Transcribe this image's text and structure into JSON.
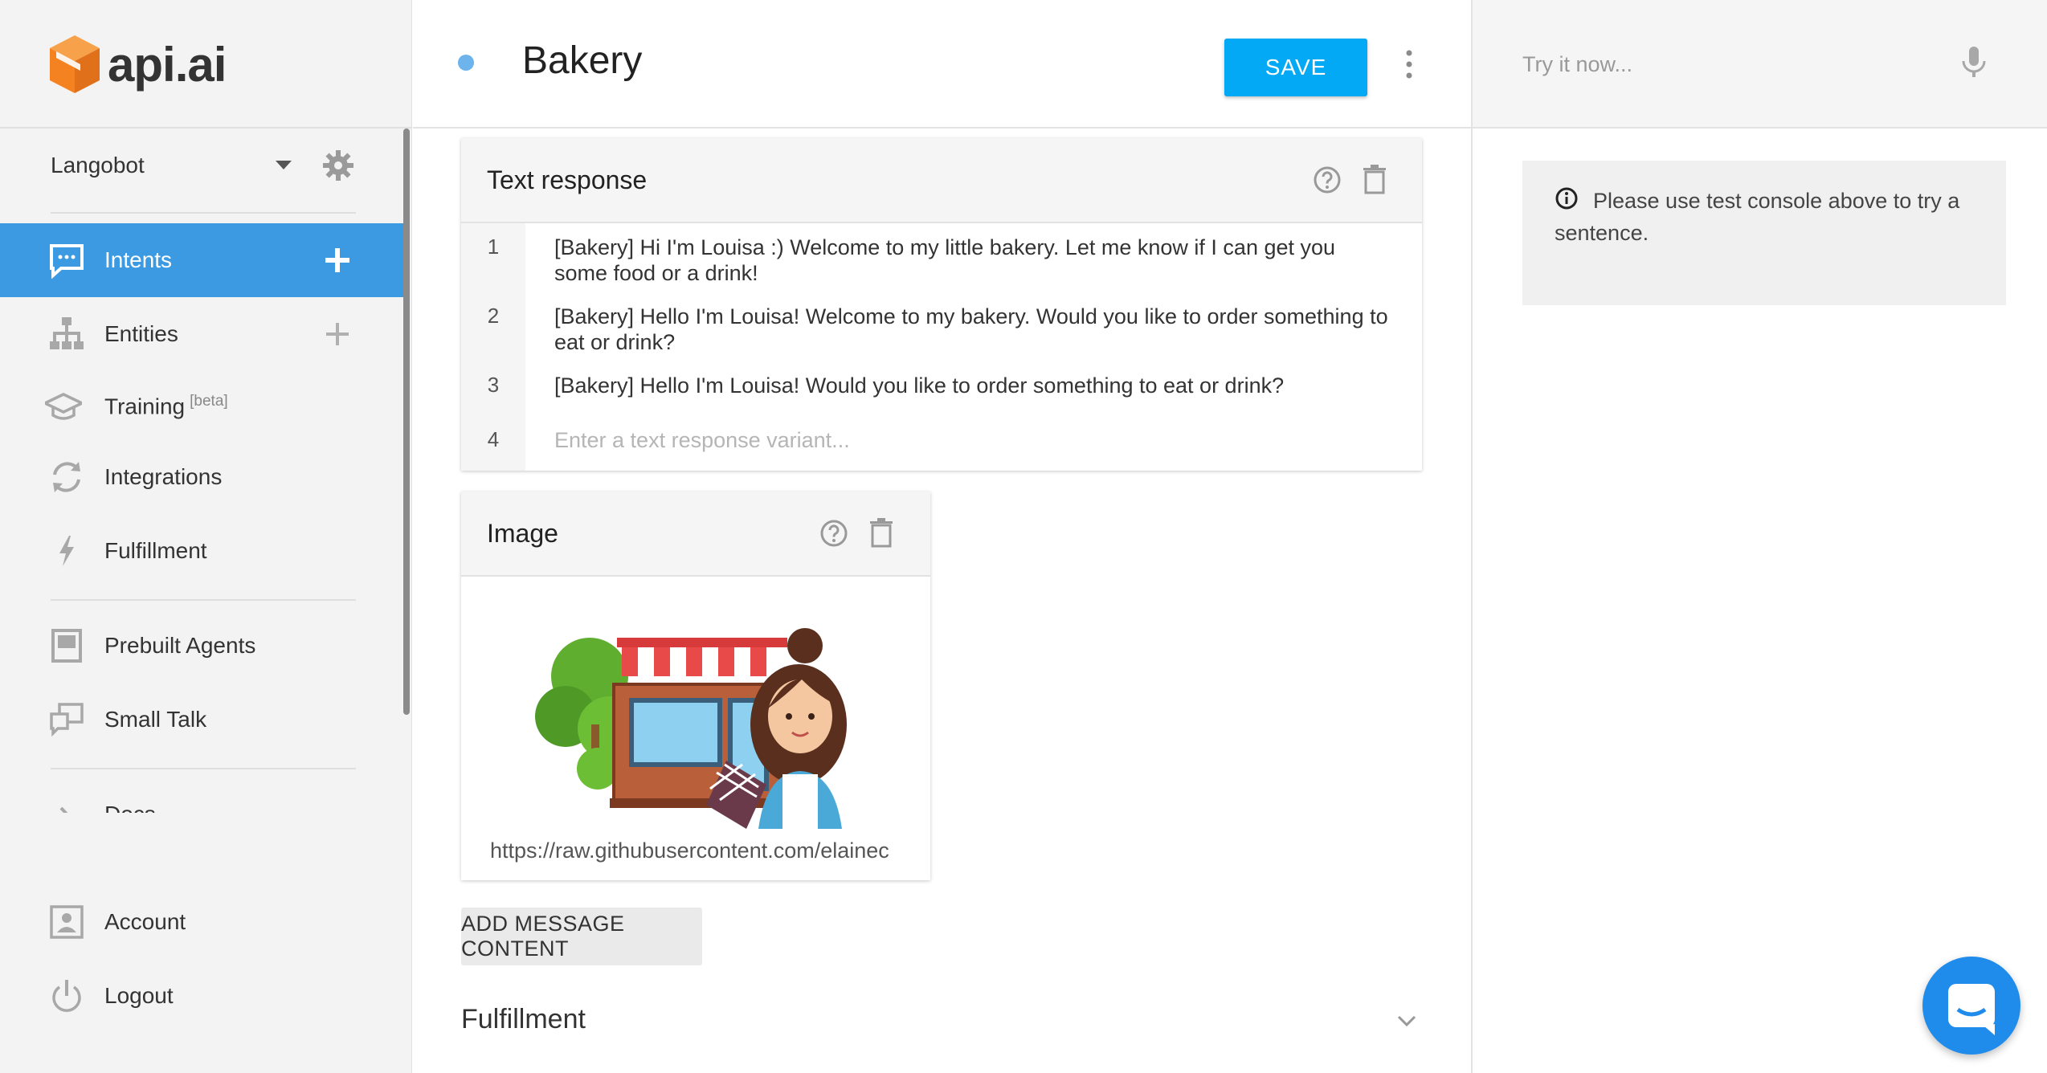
{
  "brand": {
    "name": "api.ai",
    "logo_color": "#f58220"
  },
  "sidebar": {
    "agent_name": "Langobot",
    "items": [
      {
        "label": "Intents",
        "icon": "chat-icon",
        "active": true,
        "has_add": true
      },
      {
        "label": "Entities",
        "icon": "hierarchy-icon",
        "active": false,
        "has_add": true
      },
      {
        "label": "Training",
        "badge": "[beta]",
        "icon": "graduation-cap-icon",
        "active": false
      },
      {
        "label": "Integrations",
        "icon": "sync-icon",
        "active": false
      },
      {
        "label": "Fulfillment",
        "icon": "lightning-icon",
        "active": false
      },
      {
        "label": "Prebuilt Agents",
        "icon": "book-icon",
        "active": false
      },
      {
        "label": "Small Talk",
        "icon": "chat-bubbles-icon",
        "active": false
      },
      {
        "label": "Docs",
        "icon": "chevron-right-icon",
        "active": false
      },
      {
        "label": "Account",
        "icon": "account-icon",
        "active": false
      },
      {
        "label": "Logout",
        "icon": "power-icon",
        "active": false
      }
    ],
    "active_color": "#3b9ae1"
  },
  "header": {
    "title": "Bakery",
    "save_label": "SAVE",
    "save_color": "#03a9f4"
  },
  "text_response": {
    "title": "Text response",
    "rows": [
      {
        "num": "1",
        "text": "[Bakery] Hi I'm Louisa :) Welcome to my little bakery. Let me know if I can get you some food or a drink!"
      },
      {
        "num": "2",
        "text": "[Bakery] Hello I'm Louisa! Welcome to my bakery. Would you like to order something to eat or drink?"
      },
      {
        "num": "3",
        "text": "[Bakery] Hello I'm Louisa! Would you like to order something to eat or drink?"
      }
    ],
    "new_row_num": "4",
    "placeholder": "Enter a text response variant..."
  },
  "image_card": {
    "title": "Image",
    "url": "https://raw.githubusercontent.com/elainec"
  },
  "add_content_label": "ADD MESSAGE CONTENT",
  "fulfillment_label": "Fulfillment",
  "console": {
    "placeholder": "Try it now...",
    "info": "Please use test console above to try a sentence."
  },
  "chat_fab_color": "#1f8ceb"
}
